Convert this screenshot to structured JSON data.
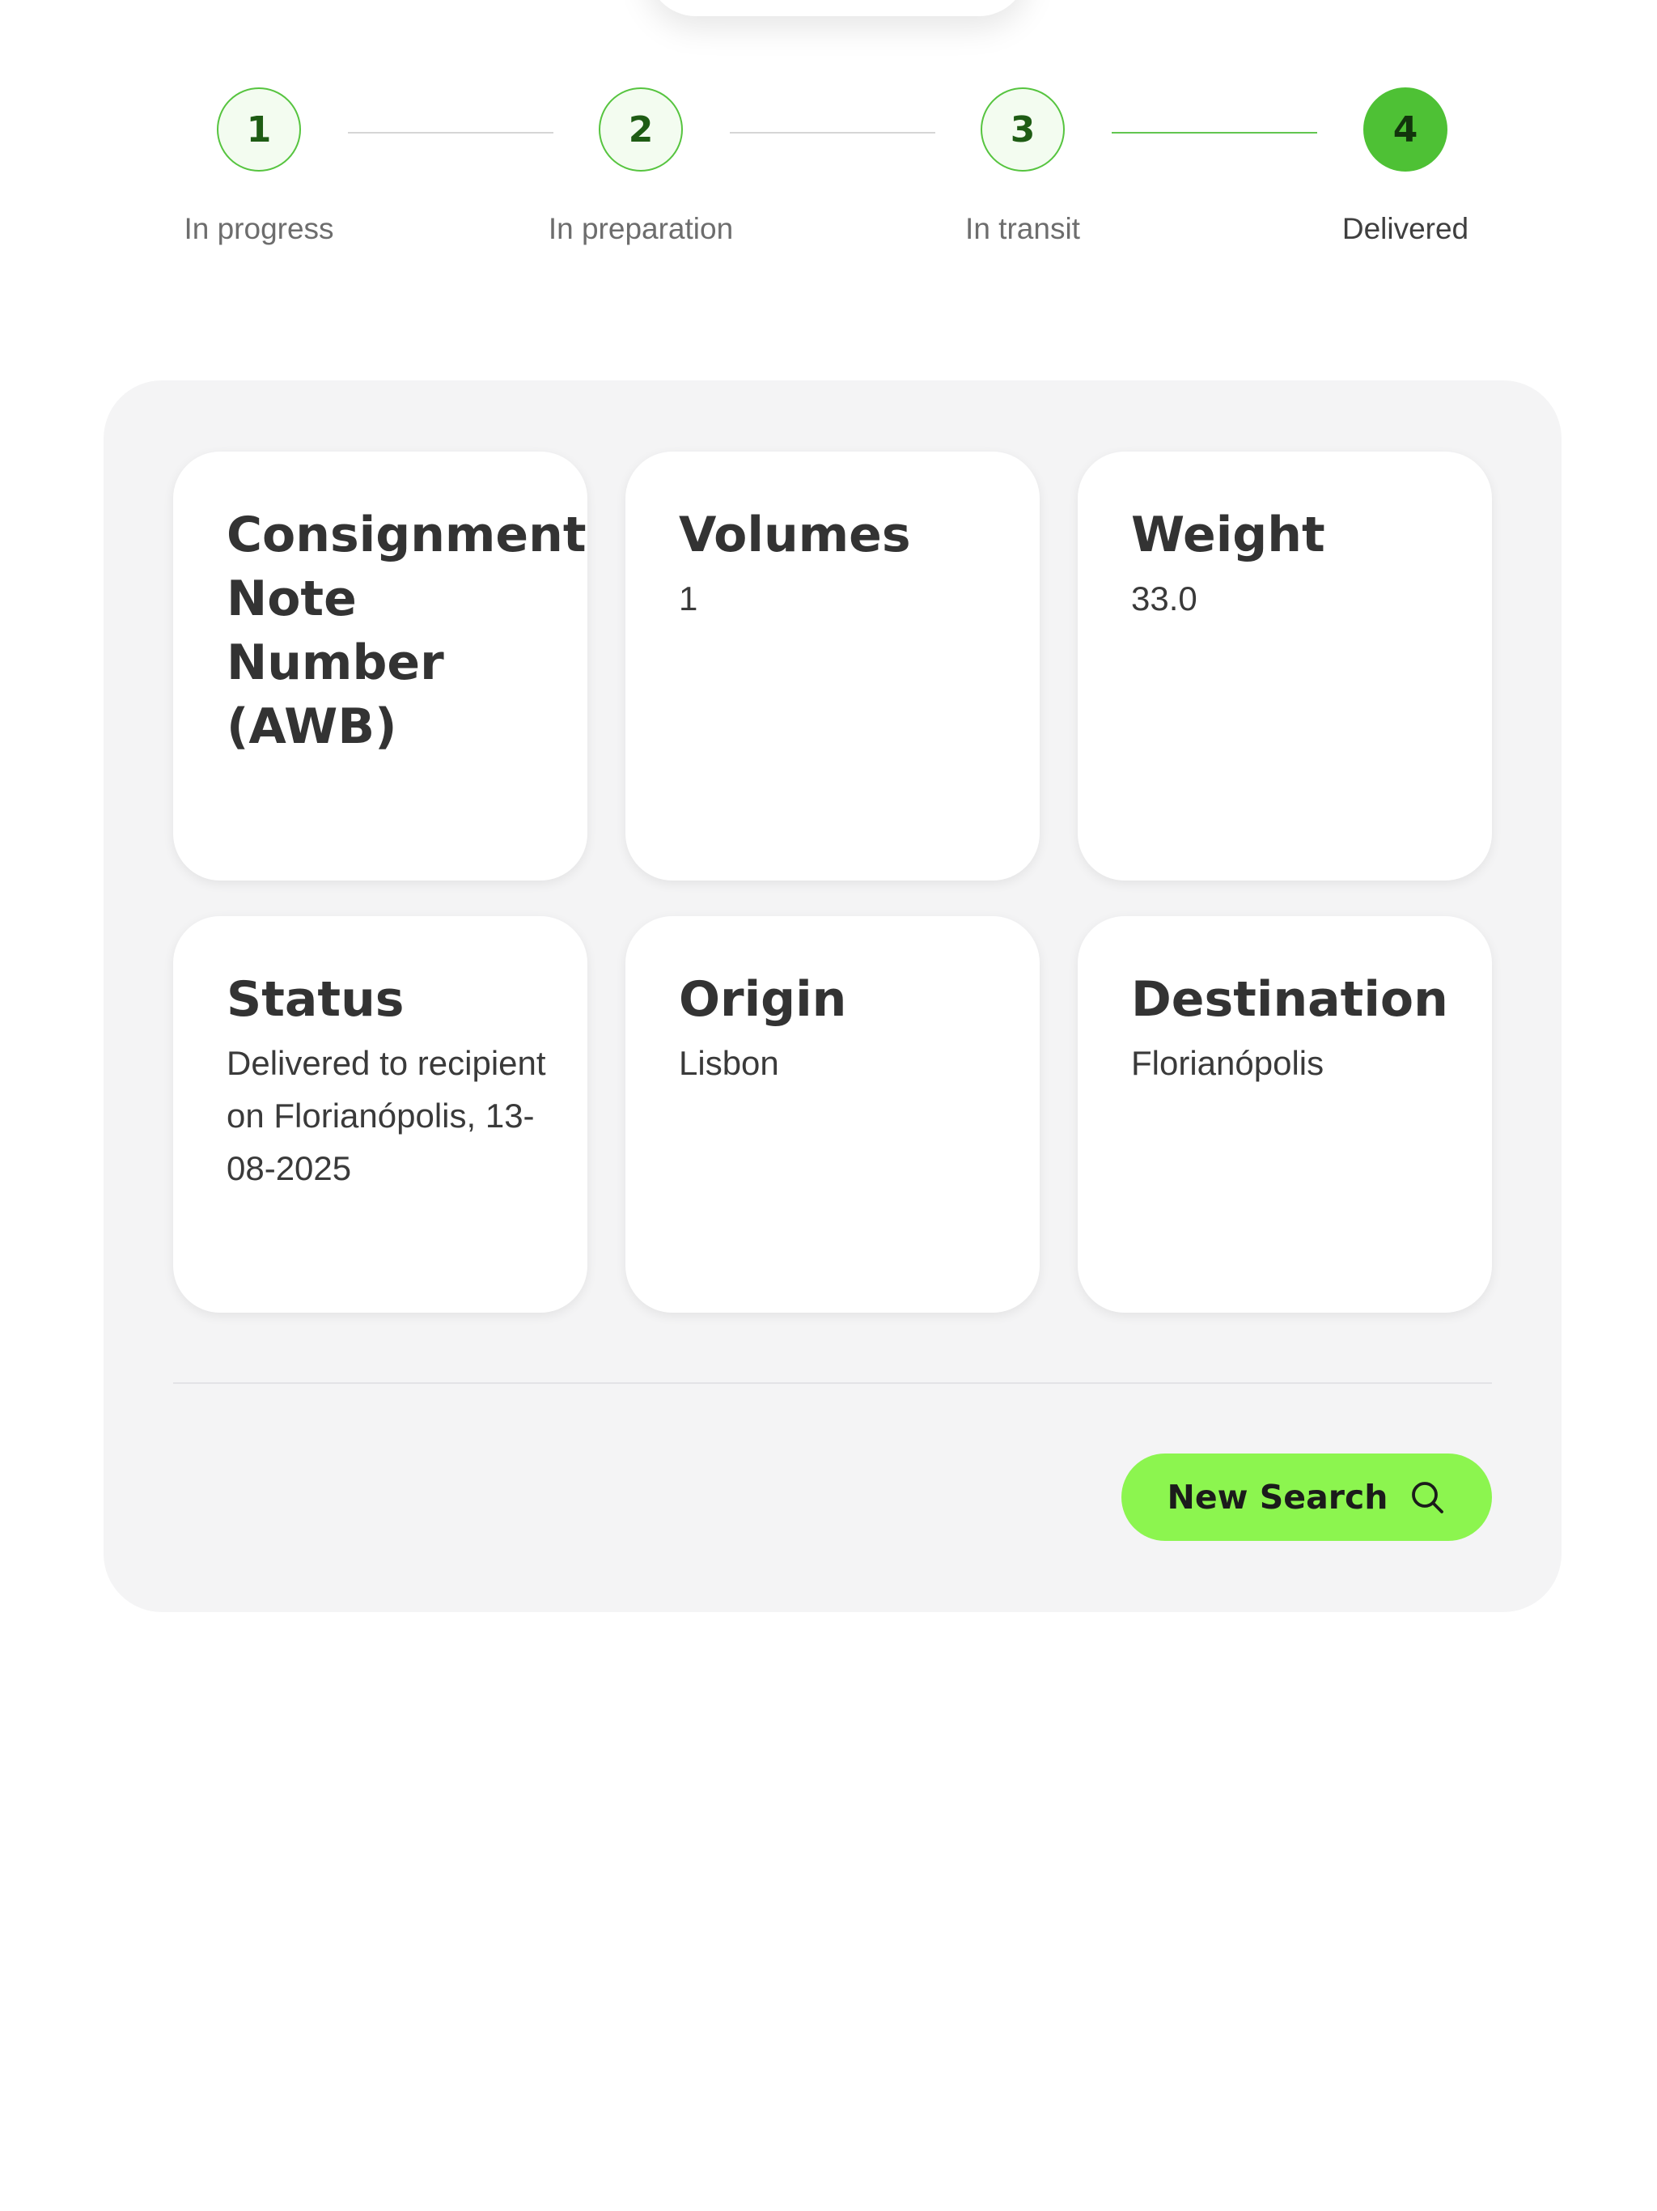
{
  "stepper": {
    "steps": [
      {
        "number": "1",
        "label": "In progress"
      },
      {
        "number": "2",
        "label": "In preparation"
      },
      {
        "number": "3",
        "label": "In transit"
      },
      {
        "number": "4",
        "label": "Delivered"
      }
    ],
    "active_step": 4,
    "colors": {
      "active": "#4ec135",
      "done_line": "#62c650",
      "pending_line": "#d6d6d6"
    }
  },
  "details": {
    "awb": {
      "title": "Consignment Note Number (AWB)",
      "value": ""
    },
    "volumes": {
      "title": "Volumes",
      "value": "1"
    },
    "weight": {
      "title": "Weight",
      "value": "33.0"
    },
    "status": {
      "title": "Status",
      "value": "Delivered to recipient on Florianópolis, 13-08-2025"
    },
    "origin": {
      "title": "Origin",
      "value": "Lisbon"
    },
    "destination": {
      "title": "Destination",
      "value": "Florianópolis"
    }
  },
  "actions": {
    "new_search_label": "New Search",
    "new_search_icon": "search-icon",
    "accent_color": "#8cf54f"
  }
}
